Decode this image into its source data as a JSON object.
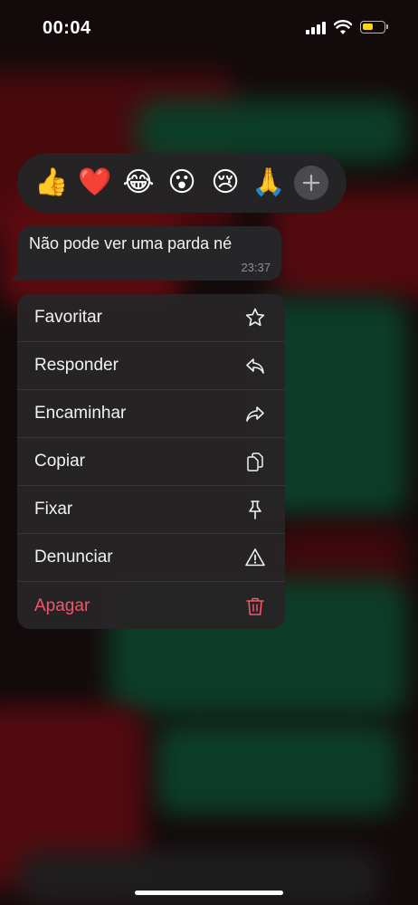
{
  "status_bar": {
    "time": "00:04",
    "battery_color": "#ffd60a"
  },
  "reactions": {
    "emojis": [
      {
        "name": "thumbs-up",
        "glyph": "👍"
      },
      {
        "name": "red-heart",
        "glyph": "❤️"
      },
      {
        "name": "tears-of-joy",
        "glyph": "😂"
      },
      {
        "name": "astonished",
        "glyph": "😮"
      },
      {
        "name": "crying",
        "glyph": "😢"
      },
      {
        "name": "folded-hands",
        "glyph": "🙏"
      }
    ],
    "more_icon": "plus-icon"
  },
  "message": {
    "text": "Não pode ver uma parda né",
    "time": "23:37"
  },
  "menu": {
    "items": [
      {
        "label": "Favoritar",
        "icon": "star-icon"
      },
      {
        "label": "Responder",
        "icon": "reply-icon"
      },
      {
        "label": "Encaminhar",
        "icon": "forward-icon"
      },
      {
        "label": "Copiar",
        "icon": "copy-icon"
      },
      {
        "label": "Fixar",
        "icon": "pin-icon"
      },
      {
        "label": "Denunciar",
        "icon": "warning-icon"
      },
      {
        "label": "Apagar",
        "icon": "trash-icon"
      }
    ],
    "danger_color": "#f0576a"
  }
}
